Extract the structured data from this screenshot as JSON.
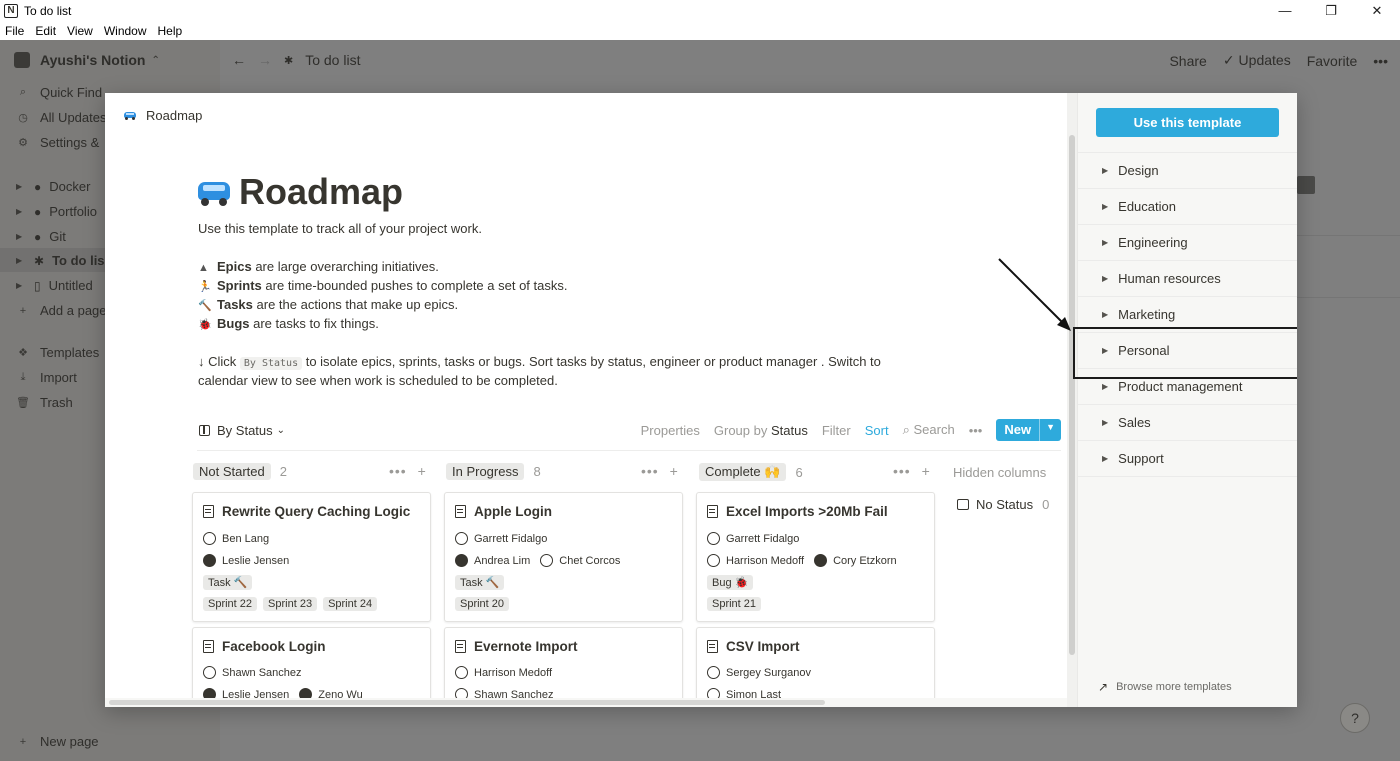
{
  "window": {
    "title": "To do list",
    "menu": [
      "File",
      "Edit",
      "View",
      "Window",
      "Help"
    ],
    "controls": [
      "—",
      "❐",
      "✕"
    ]
  },
  "sidebar": {
    "workspace": "Ayushi's Notion",
    "quick_find": "Quick Find",
    "all_updates": "All Updates",
    "settings": "Settings &",
    "pages": [
      "Docker",
      "Portfolio",
      "Git",
      "To do lis",
      "Untitled"
    ],
    "add_page": "Add a page",
    "templates": "Templates",
    "import": "Import",
    "trash": "Trash",
    "new_page": "New page"
  },
  "topbar": {
    "breadcrumb": "To do list",
    "share": "Share",
    "updates": "Updates",
    "favorite": "Favorite",
    "more": "•••"
  },
  "help": "?",
  "modal": {
    "crumb": "Roadmap",
    "title": "Roadmap",
    "intro": "Use this template to track all of your project work.",
    "bullets": [
      {
        "icon": "mountain-icon",
        "bold": "Epics",
        "text": "are large overarching initiatives."
      },
      {
        "icon": "runner-icon",
        "bold": "Sprints",
        "text": "are time-bounded pushes to complete a set of tasks."
      },
      {
        "icon": "hammer-icon",
        "bold": "Tasks",
        "text": "are the actions that make up epics."
      },
      {
        "icon": "bug-icon",
        "bold": "Bugs",
        "text": "are tasks to fix things."
      }
    ],
    "instruction_pre": "↓ Click",
    "instruction_code": "By Status",
    "instruction_post": "to isolate epics, sprints, tasks or bugs. Sort tasks by status, engineer or product manager . Switch to",
    "instruction_line2": "calendar view to see when work is scheduled to be completed.",
    "view": {
      "name": "By Status",
      "properties": "Properties",
      "group_by": "Group by",
      "group_field": "Status",
      "filter": "Filter",
      "sort": "Sort",
      "search": "Search",
      "more": "•••",
      "new": "New"
    },
    "columns": [
      {
        "label": "Not Started",
        "count": "2"
      },
      {
        "label": "In Progress",
        "count": "8"
      },
      {
        "label": "Complete 🙌",
        "count": "6"
      }
    ],
    "hidden_columns": "Hidden columns",
    "no_status": {
      "label": "No Status",
      "count": "0"
    },
    "cards": [
      {
        "title": "Rewrite Query Caching Logic",
        "people1": [
          "Ben Lang"
        ],
        "people2": [
          "Leslie Jensen"
        ],
        "type": "Task 🔨",
        "sprints": [
          "Sprint 22",
          "Sprint 23",
          "Sprint 24"
        ]
      },
      {
        "title": "Apple Login",
        "people1": [
          "Garrett Fidalgo"
        ],
        "people2": [
          "Andrea Lim",
          "Chet Corcos"
        ],
        "type": "Task 🔨",
        "sprints": [
          "Sprint 20"
        ]
      },
      {
        "title": "Excel Imports >20Mb Fail",
        "people1": [
          "Garrett Fidalgo"
        ],
        "people2": [
          "Harrison Medoff",
          "Cory Etzkorn"
        ],
        "type": "Bug 🐞",
        "sprints": [
          "Sprint 21"
        ]
      },
      {
        "title": "Facebook Login",
        "people1": [
          "Shawn Sanchez"
        ],
        "people2": [
          "Leslie Jensen",
          "Zeno Wu"
        ]
      },
      {
        "title": "Evernote Import",
        "people1": [
          "Harrison Medoff"
        ],
        "people2": [
          "Shawn Sanchez"
        ]
      },
      {
        "title": "CSV Import",
        "people1": [
          "Sergey Surganov"
        ],
        "people2": [
          "Simon Last"
        ]
      }
    ]
  },
  "templates_pane": {
    "use_button": "Use this template",
    "categories": [
      "Design",
      "Education",
      "Engineering",
      "Human resources",
      "Marketing",
      "Personal",
      "Product management",
      "Sales",
      "Support"
    ],
    "browse": "Browse more templates"
  },
  "colors": {
    "accent": "#2eaadc",
    "overlay": "#7f7f7f",
    "text": "#37352f"
  }
}
